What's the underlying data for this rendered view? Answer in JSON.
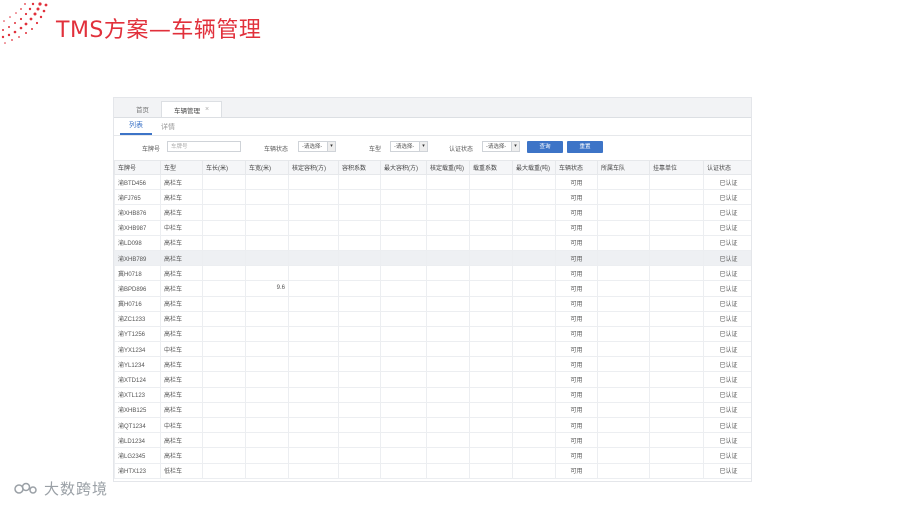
{
  "slide": {
    "title": "TMS方案—车辆管理",
    "brand": "大数跨境"
  },
  "colors": {
    "accent": "#e1303b",
    "primary": "#3d74c7"
  },
  "tabs": [
    {
      "label": "首页",
      "active": false
    },
    {
      "label": "车辆管理",
      "active": true,
      "close": "×"
    }
  ],
  "subtabs": [
    {
      "label": "列表",
      "active": true
    },
    {
      "label": "详情",
      "active": false
    }
  ],
  "filters": {
    "plate_label": "车牌号",
    "plate_placeholder": "车牌号",
    "status_label": "车辆状态",
    "status_value": "-请选择-",
    "type_label": "车型",
    "type_value": "-请选择-",
    "auth_label": "认证状态",
    "auth_value": "-请选择-",
    "query_label": "查询",
    "reset_label": "重置"
  },
  "table": {
    "columns": [
      "车牌号",
      "车型",
      "车长(米)",
      "车宽(米)",
      "核定容积(方)",
      "容积系数",
      "最大容积(方)",
      "核定载重(吨)",
      "载重系数",
      "最大载重(吨)",
      "车辆状态",
      "所属车队",
      "挂靠单位",
      "认证状态"
    ],
    "rows": [
      [
        "渝BTD456",
        "高栏车",
        "",
        "",
        "",
        "",
        "",
        "",
        "",
        "",
        "可用",
        "",
        "",
        "已认证"
      ],
      [
        "渝FJ765",
        "高栏车",
        "",
        "",
        "",
        "",
        "",
        "",
        "",
        "",
        "可用",
        "",
        "",
        "已认证"
      ],
      [
        "渝XHB876",
        "高栏车",
        "",
        "",
        "",
        "",
        "",
        "",
        "",
        "",
        "可用",
        "",
        "",
        "已认证"
      ],
      [
        "渝XHB987",
        "中栏车",
        "",
        "",
        "",
        "",
        "",
        "",
        "",
        "",
        "可用",
        "",
        "",
        "已认证"
      ],
      [
        "渝LD098",
        "高栏车",
        "",
        "",
        "",
        "",
        "",
        "",
        "",
        "",
        "可用",
        "",
        "",
        "已认证"
      ],
      [
        "渝XHB789",
        "高栏车",
        "",
        "",
        "",
        "",
        "",
        "",
        "",
        "",
        "可用",
        "",
        "",
        "已认证"
      ],
      [
        "冀H0718",
        "高栏车",
        "",
        "",
        "",
        "",
        "",
        "",
        "",
        "",
        "可用",
        "",
        "",
        "已认证"
      ],
      [
        "渝BPD896",
        "高栏车",
        "",
        "9.6",
        "",
        "",
        "",
        "",
        "",
        "",
        "可用",
        "",
        "",
        "已认证"
      ],
      [
        "冀H0716",
        "高栏车",
        "",
        "",
        "",
        "",
        "",
        "",
        "",
        "",
        "可用",
        "",
        "",
        "已认证"
      ],
      [
        "渝ZC1233",
        "高栏车",
        "",
        "",
        "",
        "",
        "",
        "",
        "",
        "",
        "可用",
        "",
        "",
        "已认证"
      ],
      [
        "渝YT1256",
        "高栏车",
        "",
        "",
        "",
        "",
        "",
        "",
        "",
        "",
        "可用",
        "",
        "",
        "已认证"
      ],
      [
        "渝YX1234",
        "中栏车",
        "",
        "",
        "",
        "",
        "",
        "",
        "",
        "",
        "可用",
        "",
        "",
        "已认证"
      ],
      [
        "渝YL1234",
        "高栏车",
        "",
        "",
        "",
        "",
        "",
        "",
        "",
        "",
        "可用",
        "",
        "",
        "已认证"
      ],
      [
        "渝XTD124",
        "高栏车",
        "",
        "",
        "",
        "",
        "",
        "",
        "",
        "",
        "可用",
        "",
        "",
        "已认证"
      ],
      [
        "渝XTL123",
        "高栏车",
        "",
        "",
        "",
        "",
        "",
        "",
        "",
        "",
        "可用",
        "",
        "",
        "已认证"
      ],
      [
        "渝XHB125",
        "高栏车",
        "",
        "",
        "",
        "",
        "",
        "",
        "",
        "",
        "可用",
        "",
        "",
        "已认证"
      ],
      [
        "渝QT1234",
        "中栏车",
        "",
        "",
        "",
        "",
        "",
        "",
        "",
        "",
        "可用",
        "",
        "",
        "已认证"
      ],
      [
        "渝LD1234",
        "高栏车",
        "",
        "",
        "",
        "",
        "",
        "",
        "",
        "",
        "可用",
        "",
        "",
        "已认证"
      ],
      [
        "渝LG2345",
        "高栏车",
        "",
        "",
        "",
        "",
        "",
        "",
        "",
        "",
        "可用",
        "",
        "",
        "已认证"
      ],
      [
        "渝HTX123",
        "低栏车",
        "",
        "",
        "",
        "",
        "",
        "",
        "",
        "",
        "可用",
        "",
        "",
        "已认证"
      ]
    ]
  }
}
